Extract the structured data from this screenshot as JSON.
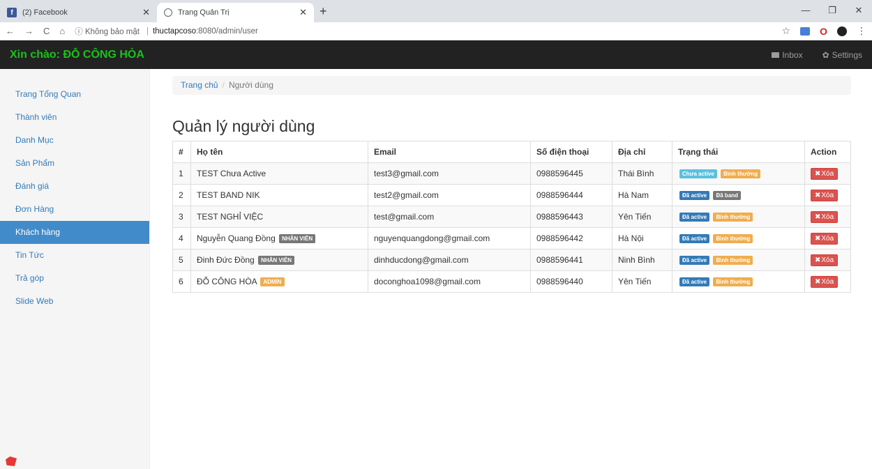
{
  "browser": {
    "tabs": [
      {
        "title": "(2) Facebook",
        "active": false
      },
      {
        "title": "Trang Quản Trị",
        "active": true
      }
    ],
    "insecure_label": "ⓘ Không bảo mật",
    "url_host": "thuctapcoso",
    "url_path": ":8080/admin/user"
  },
  "header": {
    "brand": "Xin chào: ĐỖ CÔNG HÒA",
    "inbox": "Inbox",
    "settings": "Settings"
  },
  "sidebar": {
    "items": [
      {
        "label": "Trang Tổng Quan"
      },
      {
        "label": "Thành viên"
      },
      {
        "label": "Danh Mục"
      },
      {
        "label": "Sản Phẩm"
      },
      {
        "label": "Đánh giá"
      },
      {
        "label": "Đơn Hàng"
      },
      {
        "label": "Khách hàng",
        "active": true
      },
      {
        "label": "Tin Tức"
      },
      {
        "label": "Trả góp"
      },
      {
        "label": "Slide Web"
      }
    ]
  },
  "breadcrumb": {
    "home": "Trang chủ",
    "current": "Người dùng"
  },
  "page_title": "Quản lý người dùng",
  "table": {
    "headers": [
      "#",
      "Họ tên",
      "Email",
      "Số điện thoại",
      "Địa chỉ",
      "Trạng thái",
      "Action"
    ],
    "rows": [
      {
        "id": "1",
        "name": "TEST Chưa Active",
        "role": "",
        "email": "test3@gmail.com",
        "phone": "0988596445",
        "address": "Thái Bình",
        "active": "Chưa active",
        "status": "Bình thường"
      },
      {
        "id": "2",
        "name": "TEST BAND NIK",
        "role": "",
        "email": "test2@gmail.com",
        "phone": "0988596444",
        "address": "Hà Nam",
        "active": "Đã active",
        "status": "Đã band"
      },
      {
        "id": "3",
        "name": "TEST NGHỈ VIỆC",
        "role": "",
        "email": "test@gmail.com",
        "phone": "0988596443",
        "address": "Yên Tiến",
        "active": "Đã active",
        "status": "Bình thường"
      },
      {
        "id": "4",
        "name": "Nguyễn Quang Đồng",
        "role": "NHÂN VIÊN",
        "email": "nguyenquangdong@gmail.com",
        "phone": "0988596442",
        "address": "Hà Nội",
        "active": "Đã active",
        "status": "Bình thường"
      },
      {
        "id": "5",
        "name": "Đinh Đức Đồng",
        "role": "NHÂN VIÊN",
        "email": "dinhducdong@gmail.com",
        "phone": "0988596441",
        "address": "Ninh Bình",
        "active": "Đã active",
        "status": "Bình thường"
      },
      {
        "id": "6",
        "name": "ĐỖ CÔNG HÒA",
        "role": "ADMIN",
        "email": "doconghoa1098@gmail.com",
        "phone": "0988596440",
        "address": "Yên Tiến",
        "active": "Đã active",
        "status": "Bình thường"
      }
    ],
    "delete_label": "Xóa"
  }
}
